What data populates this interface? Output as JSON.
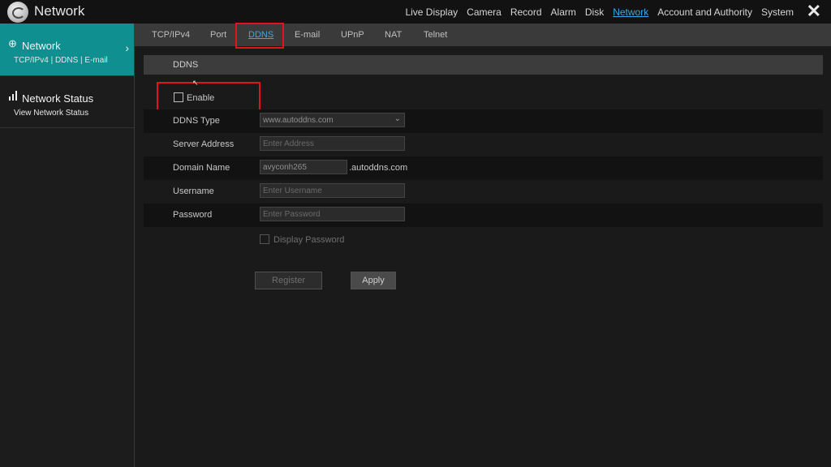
{
  "app": {
    "title": "Network"
  },
  "topnav": {
    "items": [
      "Live Display",
      "Camera",
      "Record",
      "Alarm",
      "Disk",
      "Network",
      "Account and Authority",
      "System"
    ],
    "active": "Network"
  },
  "sidebar": {
    "items": [
      {
        "title": "Network",
        "subtitle": "TCP/IPv4 | DDNS | E-mail",
        "icon": "globe-icon",
        "active": true
      },
      {
        "title": "Network Status",
        "subtitle": "View Network Status",
        "icon": "signal-bars-icon",
        "active": false
      }
    ]
  },
  "tabs": {
    "items": [
      "TCP/IPv4",
      "Port",
      "DDNS",
      "E-mail",
      "UPnP",
      "NAT",
      "Telnet"
    ],
    "active": "DDNS"
  },
  "section": {
    "title": "DDNS"
  },
  "form": {
    "enable_label": "Enable",
    "enable_checked": false,
    "ddns_type": {
      "label": "DDNS Type",
      "value": "www.autoddns.com"
    },
    "server_address": {
      "label": "Server Address",
      "placeholder": "Enter Address"
    },
    "domain_name": {
      "label": "Domain Name",
      "value": "avyconh265",
      "suffix": ".autoddns.com"
    },
    "username": {
      "label": "Username",
      "placeholder": "Enter Username"
    },
    "password": {
      "label": "Password",
      "placeholder": "Enter Password"
    },
    "display_password_label": "Display Password",
    "display_password_checked": false
  },
  "buttons": {
    "register": "Register",
    "apply": "Apply"
  },
  "colors": {
    "accent": "#0f8f8f",
    "active_link": "#3aa7e8",
    "highlight": "#e0141c"
  }
}
